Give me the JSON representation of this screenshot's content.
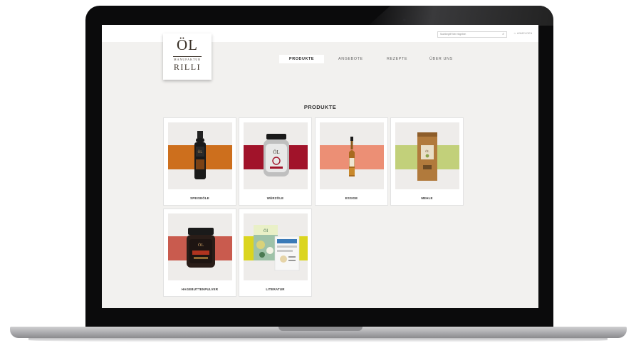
{
  "search": {
    "placeholder": "Suchbegriff hier eingeben"
  },
  "header": {
    "login_label": "ANMELDEN"
  },
  "logo": {
    "top": "ÖL",
    "middle": "MANUFAKTUR",
    "bottom": "RILLI"
  },
  "nav": {
    "items": [
      {
        "label": "PRODUKTE",
        "active": true
      },
      {
        "label": "ANGEBOTE"
      },
      {
        "label": "REZEPTE"
      },
      {
        "label": "ÜBER UNS"
      }
    ]
  },
  "main": {
    "title": "PRODUKTE",
    "categories": [
      {
        "label": "SPEISEÖLE",
        "color": "#cd6f1d"
      },
      {
        "label": "WÜRZÖLE",
        "color": "#a1132a"
      },
      {
        "label": "ESSIGE",
        "color": "#ec8f75"
      },
      {
        "label": "MEHLE",
        "color": "#c2d07a"
      },
      {
        "label": "HAGEBUTTENPULVER",
        "color": "#c95b4e"
      },
      {
        "label": "LITERATUR",
        "color": "#dbd51f"
      }
    ]
  }
}
